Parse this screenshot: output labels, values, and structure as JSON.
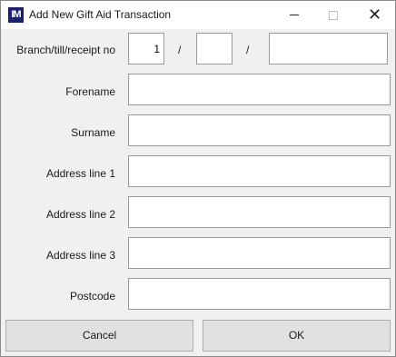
{
  "window": {
    "title": "Add New Gift Aid Transaction",
    "icon_text": "IM",
    "close_glyph": "✕"
  },
  "form": {
    "branch_label": "Branch/till/receipt no",
    "branch_value": "1",
    "till_value": "",
    "receipt_value": "",
    "separator": "/",
    "forename_label": "Forename",
    "forename_value": "",
    "surname_label": "Surname",
    "surname_value": "",
    "address1_label": "Address line 1",
    "address1_value": "",
    "address2_label": "Address line 2",
    "address2_value": "",
    "address3_label": "Address line 3",
    "address3_value": "",
    "postcode_label": "Postcode",
    "postcode_value": ""
  },
  "buttons": {
    "cancel": "Cancel",
    "ok": "OK"
  }
}
